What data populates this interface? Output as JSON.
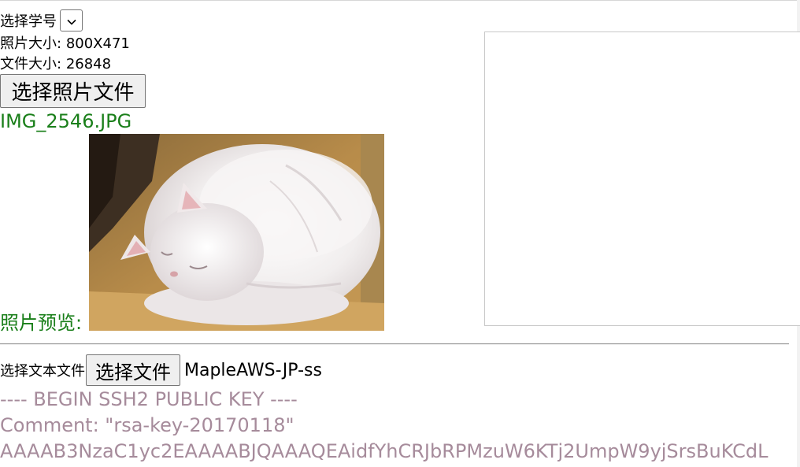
{
  "student": {
    "label": "选择学号",
    "selected": ""
  },
  "photo_info": {
    "size_label": "照片大小:",
    "size_value": "800X471",
    "file_size_label": "文件大小:",
    "file_size_value": "26848"
  },
  "photo_select": {
    "button_label": "选择照片文件",
    "filename": "IMG_2546.JPG",
    "preview_label": "照片预览:"
  },
  "text_select": {
    "label": "选择文本文件",
    "button_label": "选择文件",
    "filename": "MapleAWS-JP-ss"
  },
  "text_content": {
    "lines": [
      "---- BEGIN SSH2 PUBLIC KEY ----",
      "Comment: \"rsa-key-20170118\"",
      "AAAAB3NzaC1yc2EAAAABJQAAAQEAidfYhCRJbRPMzuW6KTj2UmpW9yjSrsBuKCdL"
    ]
  },
  "colors": {
    "filename_green": "#1a7f1a",
    "text_content_mauve": "#a68b9b"
  }
}
